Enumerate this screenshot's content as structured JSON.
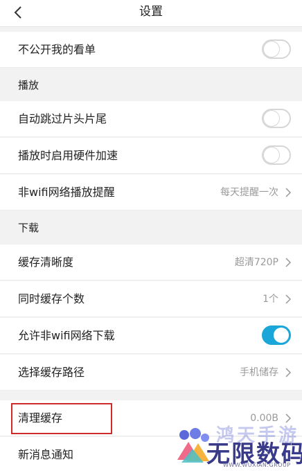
{
  "header": {
    "title": "设置"
  },
  "rows": [
    {
      "label": "不公开我的看单",
      "toggle": false
    },
    {
      "label": "自动跳过片头片尾",
      "toggle": false
    },
    {
      "label": "播放时启用硬件加速",
      "toggle": false
    },
    {
      "label": "非wifi网络播放提醒",
      "value": "每天提醒一次"
    },
    {
      "label": "缓存清晰度",
      "value": "超清720P"
    },
    {
      "label": "同时缓存个数",
      "value": "1个"
    },
    {
      "label": "允许非wifi网络下载",
      "toggle": true
    },
    {
      "label": "选择缓存路径",
      "value": "手机储存"
    },
    {
      "label": "清理缓存",
      "value": "0.00B"
    },
    {
      "label": "新消息通知"
    }
  ],
  "sections": {
    "play": "播放",
    "download": "下载"
  },
  "watermark": {
    "top": "鸿天手游",
    "main": "无限数码",
    "url": "WWW.WUXIAN.GROUP"
  },
  "colors": {
    "accent": "#1aa6d8",
    "highlight": "#cf2a2a"
  }
}
